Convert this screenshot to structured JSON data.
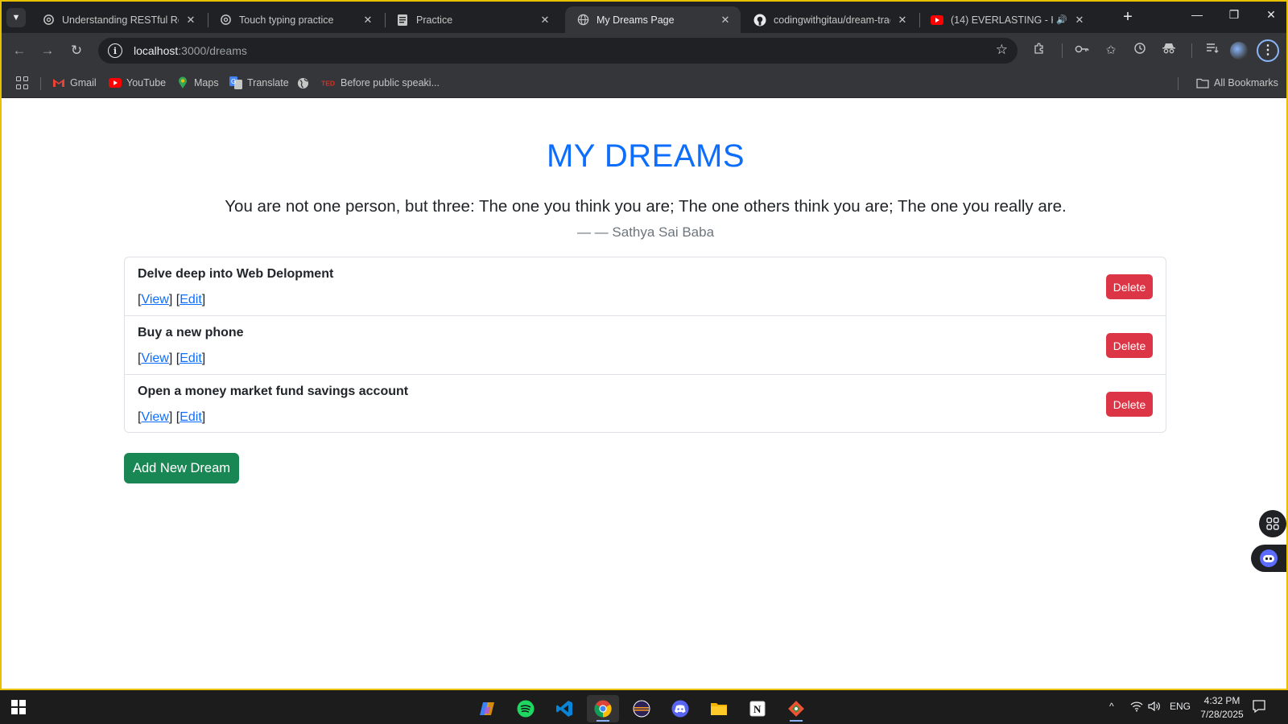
{
  "browser": {
    "tabs": [
      {
        "title": "Understanding RESTful Route",
        "icon": "openai-icon"
      },
      {
        "title": "Touch typing practice",
        "icon": "openai-icon"
      },
      {
        "title": "Practice",
        "icon": "document-icon"
      },
      {
        "title": "My Dreams Page",
        "icon": "globe-icon",
        "active": true
      },
      {
        "title": "codingwithgitau/dream-track",
        "icon": "github-icon"
      },
      {
        "title": "(14) EVERLASTING - Kanj",
        "icon": "youtube-icon",
        "audio": true
      }
    ],
    "address": {
      "host": "localhost",
      "path": ":3000/dreams"
    },
    "bookmarks": [
      {
        "label": "Gmail",
        "icon": "gmail-icon"
      },
      {
        "label": "YouTube",
        "icon": "youtube-icon"
      },
      {
        "label": "Maps",
        "icon": "maps-icon"
      },
      {
        "label": "Translate",
        "icon": "translate-icon"
      },
      {
        "label": "",
        "icon": "globe-icon"
      },
      {
        "label": "Before public speaki...",
        "icon": "ted-icon"
      }
    ],
    "all_bookmarks_label": "All Bookmarks"
  },
  "page": {
    "title": "MY DREAMS",
    "quote": "You are not one person, but three: The one you think you are; The one others think you are; The one you really are.",
    "author": "— — Sathya Sai Baba",
    "dreams": [
      {
        "title": "Delve deep into Web Delopment",
        "view": "View",
        "edit": "Edit",
        "delete": "Delete"
      },
      {
        "title": "Buy a new phone",
        "view": "View",
        "edit": "Edit",
        "delete": "Delete"
      },
      {
        "title": "Open a money market fund savings account",
        "view": "View",
        "edit": "Edit",
        "delete": "Delete"
      }
    ],
    "add_button": "Add New Dream"
  },
  "taskbar": {
    "language": "ENG",
    "time": "4:32 PM",
    "date": "7/28/2025"
  },
  "colors": {
    "title_blue": "#0d6efd",
    "delete_red": "#dc3545",
    "add_green": "#198754",
    "frame_yellow": "#e8c200"
  }
}
